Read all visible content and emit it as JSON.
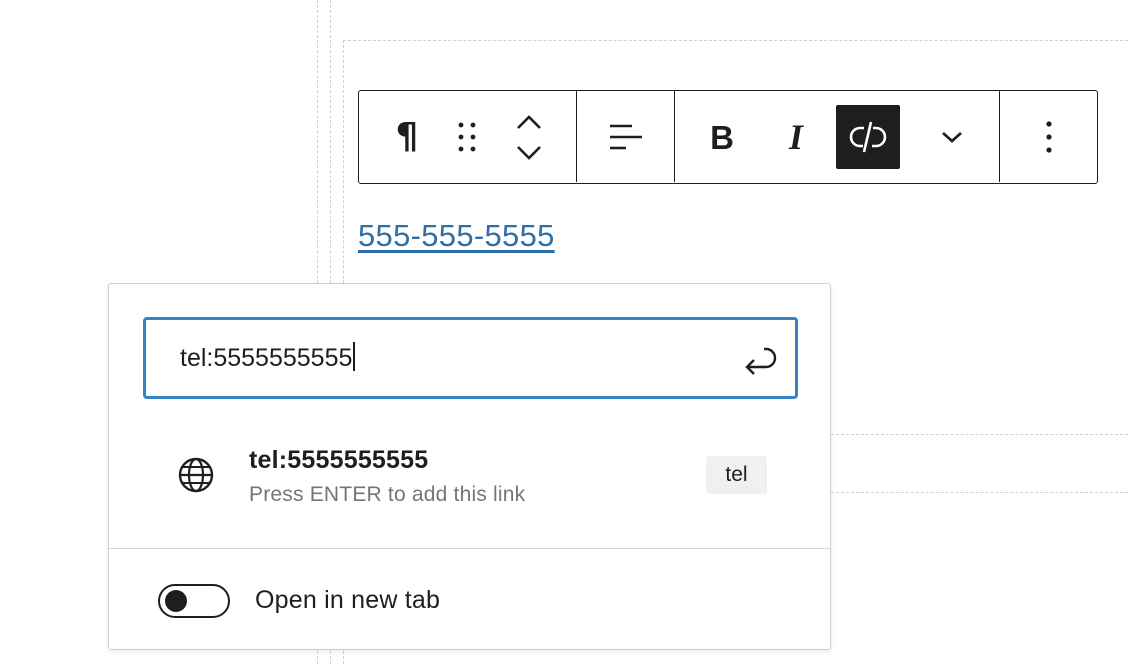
{
  "toolbar": {
    "paragraph_icon": "¶",
    "drag_handle_icon": "drag-handle-icon",
    "move_icon": "chevron-up-down-icon",
    "align_icon": "align-left-icon",
    "bold_label": "B",
    "italic_label": "I",
    "unlink_icon": "unlink-icon",
    "more_format_icon": "chevron-down-icon",
    "options_icon": "more-vertical-icon",
    "active_color": "#1e1e1e"
  },
  "content": {
    "link_text": "555-555-5555",
    "link_color": "#2f6ea7"
  },
  "link_popover": {
    "url_input_value": "tel:5555555555",
    "submit_icon": "enter-icon",
    "focus_color": "#3582c4",
    "suggestion": {
      "icon": "globe-icon",
      "title": "tel:5555555555",
      "hint": "Press ENTER to add this link",
      "type_badge": "tel"
    },
    "new_tab_toggle": {
      "label": "Open in new tab",
      "checked": false
    }
  }
}
